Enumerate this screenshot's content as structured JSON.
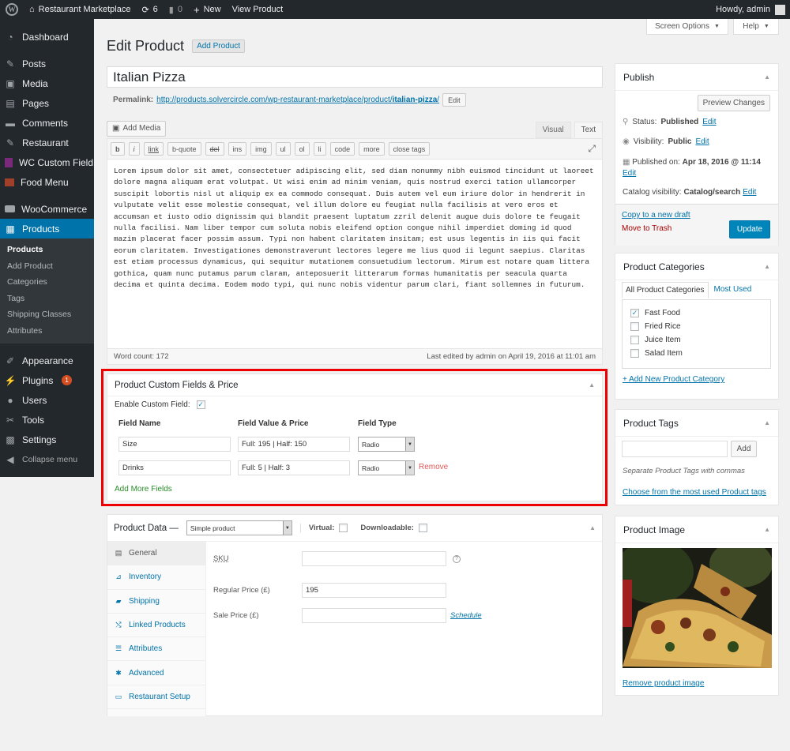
{
  "adminbar": {
    "site_name": "Restaurant Marketplace",
    "updates_count": "6",
    "comments_count": "0",
    "new_label": "New",
    "view_label": "View Product",
    "howdy": "Howdy, admin"
  },
  "sidebar": {
    "items": [
      {
        "label": "Dashboard",
        "icon": "dashboard-icon"
      },
      {
        "label": "Posts",
        "icon": "pin-icon"
      },
      {
        "label": "Media",
        "icon": "media-icon"
      },
      {
        "label": "Pages",
        "icon": "pages-icon"
      },
      {
        "label": "Comments",
        "icon": "comment-icon"
      },
      {
        "label": "Restaurant",
        "icon": "pin-icon"
      },
      {
        "label": "WC Custom Field",
        "icon": "wc-icon"
      },
      {
        "label": "Food Menu",
        "icon": "food-icon"
      },
      {
        "label": "WooCommerce",
        "icon": "woocommerce-icon"
      },
      {
        "label": "Products",
        "icon": "products-icon"
      },
      {
        "label": "Appearance",
        "icon": "brush-icon"
      },
      {
        "label": "Plugins",
        "icon": "plugin-icon",
        "badge": "1"
      },
      {
        "label": "Users",
        "icon": "users-icon"
      },
      {
        "label": "Tools",
        "icon": "wrench-icon"
      },
      {
        "label": "Settings",
        "icon": "settings-icon"
      },
      {
        "label": "Collapse menu",
        "icon": "collapse-icon"
      }
    ],
    "submenu": [
      "Products",
      "Add Product",
      "Categories",
      "Tags",
      "Shipping Classes",
      "Attributes"
    ]
  },
  "top_buttons": {
    "screen_options": "Screen Options",
    "help": "Help"
  },
  "page": {
    "title": "Edit Product",
    "add_new": "Add Product",
    "product_title": "Italian Pizza",
    "permalink_label": "Permalink:",
    "permalink_base": "http://products.solvercircle.com/wp-restaurant-marketplace/product/",
    "permalink_slug": "italian-pizza",
    "permalink_end": "/",
    "permalink_edit": "Edit"
  },
  "editor": {
    "add_media": "Add Media",
    "tab_visual": "Visual",
    "tab_text": "Text",
    "quicktags": [
      "b",
      "i",
      "link",
      "b-quote",
      "del",
      "ins",
      "img",
      "ul",
      "ol",
      "li",
      "code",
      "more",
      "close tags"
    ],
    "content": "Lorem ipsum dolor sit amet, consectetuer adipiscing elit, sed diam nonummy nibh euismod tincidunt ut laoreet dolore magna aliquam erat volutpat. Ut wisi enim ad minim veniam, quis nostrud exerci tation ullamcorper suscipit lobortis nisl ut aliquip ex ea commodo consequat. Duis autem vel eum iriure dolor in hendrerit in vulputate velit esse molestie consequat, vel illum dolore eu feugiat nulla facilisis at vero eros et accumsan et iusto odio dignissim qui blandit praesent luptatum zzril delenit augue duis dolore te feugait nulla facilisi. Nam liber tempor cum soluta nobis eleifend option congue nihil imperdiet doming id quod mazim placerat facer possim assum. Typi non habent claritatem insitam; est usus legentis in iis qui facit eorum claritatem. Investigationes demonstraverunt lectores legere me lius quod ii legunt saepius. Claritas est etiam processus dynamicus, qui sequitur mutationem consuetudium lectorum. Mirum est notare quam littera gothica, quam nunc putamus parum claram, anteposuerit litterarum formas humanitatis per seacula quarta decima et quinta decima. Eodem modo typi, qui nunc nobis videntur parum clari, fiant sollemnes in futurum.",
    "word_count": "Word count: 172",
    "last_edited": "Last edited by admin on April 19, 2016 at 11:01 am"
  },
  "custom_fields": {
    "title": "Product Custom Fields & Price",
    "enable_label": "Enable Custom Field:",
    "col_name": "Field Name",
    "col_value": "Field Value & Price",
    "col_type": "Field Type",
    "rows": [
      {
        "name": "Size",
        "value": "Full: 195 | Half: 150",
        "type": "Radio"
      },
      {
        "name": "Drinks",
        "value": "Full: 5 | Half: 3",
        "type": "Radio",
        "remove": "Remove"
      }
    ],
    "add_more": "Add More Fields"
  },
  "product_data": {
    "title": "Product Data —",
    "type_select": "Simple product",
    "virtual": "Virtual:",
    "downloadable": "Downloadable:",
    "tabs": [
      {
        "label": "General",
        "icon": "wrench-icon"
      },
      {
        "label": "Inventory",
        "icon": "chart-icon"
      },
      {
        "label": "Shipping",
        "icon": "truck-icon"
      },
      {
        "label": "Linked Products",
        "icon": "link-icon"
      },
      {
        "label": "Attributes",
        "icon": "list-icon"
      },
      {
        "label": "Advanced",
        "icon": "gear-icon"
      },
      {
        "label": "Restaurant Setup",
        "icon": "window-icon"
      }
    ],
    "sku_label": "SKU",
    "regular_label": "Regular Price (£)",
    "regular_value": "195",
    "sale_label": "Sale Price (£)",
    "schedule": "Schedule"
  },
  "publish": {
    "title": "Publish",
    "preview": "Preview Changes",
    "status_label": "Status:",
    "status_value": "Published",
    "visibility_label": "Visibility:",
    "visibility_value": "Public",
    "published_label": "Published on:",
    "published_value": "Apr 18, 2016 @ 11:14",
    "catalog_label": "Catalog visibility:",
    "catalog_value": "Catalog/search",
    "edit": "Edit",
    "copy": "Copy to a new draft",
    "trash": "Move to Trash",
    "update": "Update"
  },
  "categories": {
    "title": "Product Categories",
    "tab_all": "All Product Categories",
    "tab_used": "Most Used",
    "items": [
      {
        "label": "Fast Food",
        "checked": true
      },
      {
        "label": "Fried Rice",
        "checked": false
      },
      {
        "label": "Juice Item",
        "checked": false
      },
      {
        "label": "Salad Item",
        "checked": false
      }
    ],
    "add_new": "+ Add New Product Category"
  },
  "tags": {
    "title": "Product Tags",
    "add": "Add",
    "hint": "Separate Product Tags with commas",
    "choose": "Choose from the most used Product tags"
  },
  "image": {
    "title": "Product Image",
    "remove": "Remove product image"
  },
  "colors": {
    "accent": "#0073aa",
    "admin_bg": "#23282d",
    "highlight": "#e00000"
  }
}
